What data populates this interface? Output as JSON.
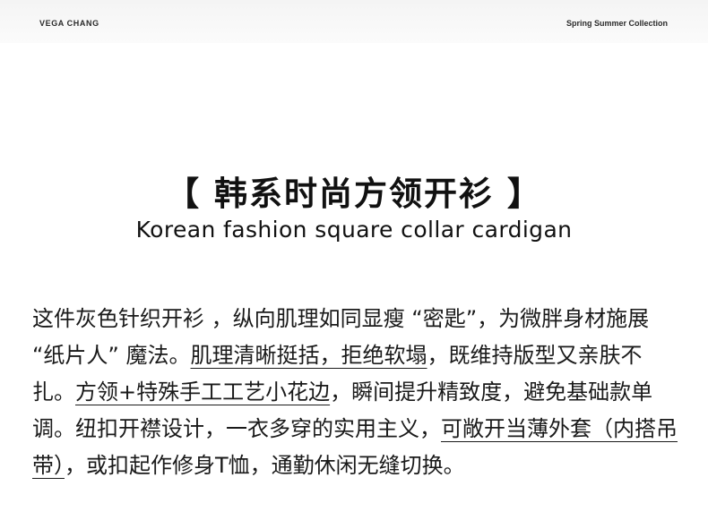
{
  "header": {
    "brand": "VEGA CHANG",
    "collection": "Spring Summer Collection"
  },
  "title": "【 韩系时尚方领开衫 】",
  "subtitle": "Korean fashion square collar cardigan",
  "description": {
    "seg1": "这件灰色针织开衫 ，纵向肌理如同显瘦 “密匙”，为微胖身材施展 “纸片人” 魔法。",
    "seg2": "肌理清晰挺括，拒绝软塌",
    "seg3": "，既维持版型又亲肤不扎。",
    "seg4": "方领+特殊手工工艺小花边",
    "seg5": "，瞬间提升精致度，避免基础款单调。纽扣开襟设计，一衣多穿的实用主义，",
    "seg6": "可敞开当薄外套（内搭吊带）",
    "seg7": "，或扣起作修身T恤，通勤休闲无缝切换。"
  }
}
